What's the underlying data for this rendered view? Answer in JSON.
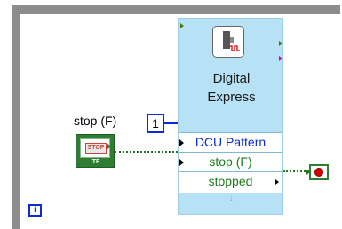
{
  "express_vi": {
    "title_line1": "Digital",
    "title_line2": "Express",
    "terminals": {
      "dcu_pattern": "DCU Pattern",
      "stop": "stop (F)",
      "stopped": "stopped"
    },
    "icon": "express-vi-waveform-icon"
  },
  "constant": {
    "value": "1"
  },
  "stop_control": {
    "label": "stop (F)",
    "button_text": "STOP",
    "type_text": "TF"
  },
  "loop": {
    "iteration_label": "i",
    "condition_icon": "stop-if-true-icon"
  },
  "colors": {
    "loop_frame": "#8c8c8c",
    "express_vi_bg": "#b7e1f4",
    "numeric_wire": "#0b2bd6",
    "boolean_wire": "#1f7a1f",
    "stop_red": "#d50000"
  }
}
